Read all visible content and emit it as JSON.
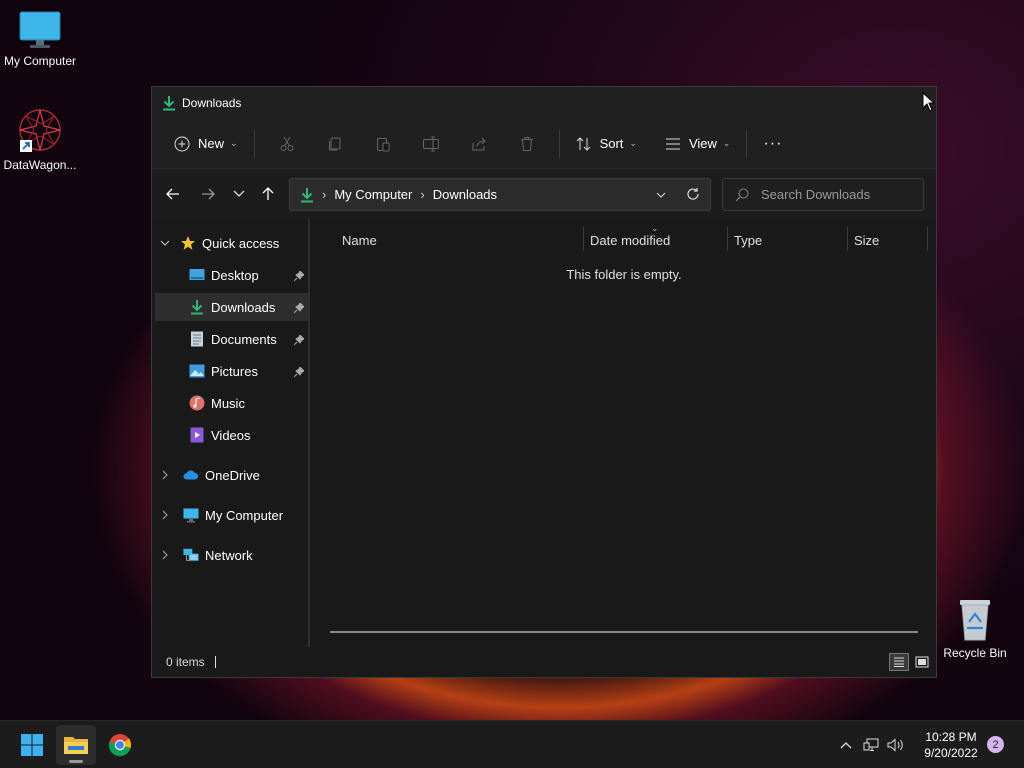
{
  "desktop": {
    "icons": [
      {
        "label": "My Computer"
      },
      {
        "label": "DataWagon..."
      },
      {
        "label": "Recycle Bin"
      }
    ]
  },
  "window": {
    "title": "Downloads",
    "toolbar": {
      "new_label": "New",
      "sort_label": "Sort",
      "view_label": "View",
      "more_label": "···"
    },
    "address": {
      "crumbs": [
        "My Computer",
        "Downloads"
      ]
    },
    "search": {
      "placeholder": "Search Downloads"
    },
    "sidebar": {
      "quick_access": "Quick access",
      "items": [
        {
          "label": "Desktop",
          "pinned": true
        },
        {
          "label": "Downloads",
          "pinned": true,
          "active": true
        },
        {
          "label": "Documents",
          "pinned": true
        },
        {
          "label": "Pictures",
          "pinned": true
        },
        {
          "label": "Music",
          "pinned": false
        },
        {
          "label": "Videos",
          "pinned": false
        }
      ],
      "onedrive": "OneDrive",
      "my_computer": "My Computer",
      "network": "Network"
    },
    "columns": [
      "Name",
      "Date modified",
      "Type",
      "Size"
    ],
    "empty_message": "This folder is empty.",
    "status": {
      "items_count": "0 items"
    }
  },
  "taskbar": {
    "time": "10:28 PM",
    "date": "9/20/2022",
    "notification_count": "2"
  }
}
